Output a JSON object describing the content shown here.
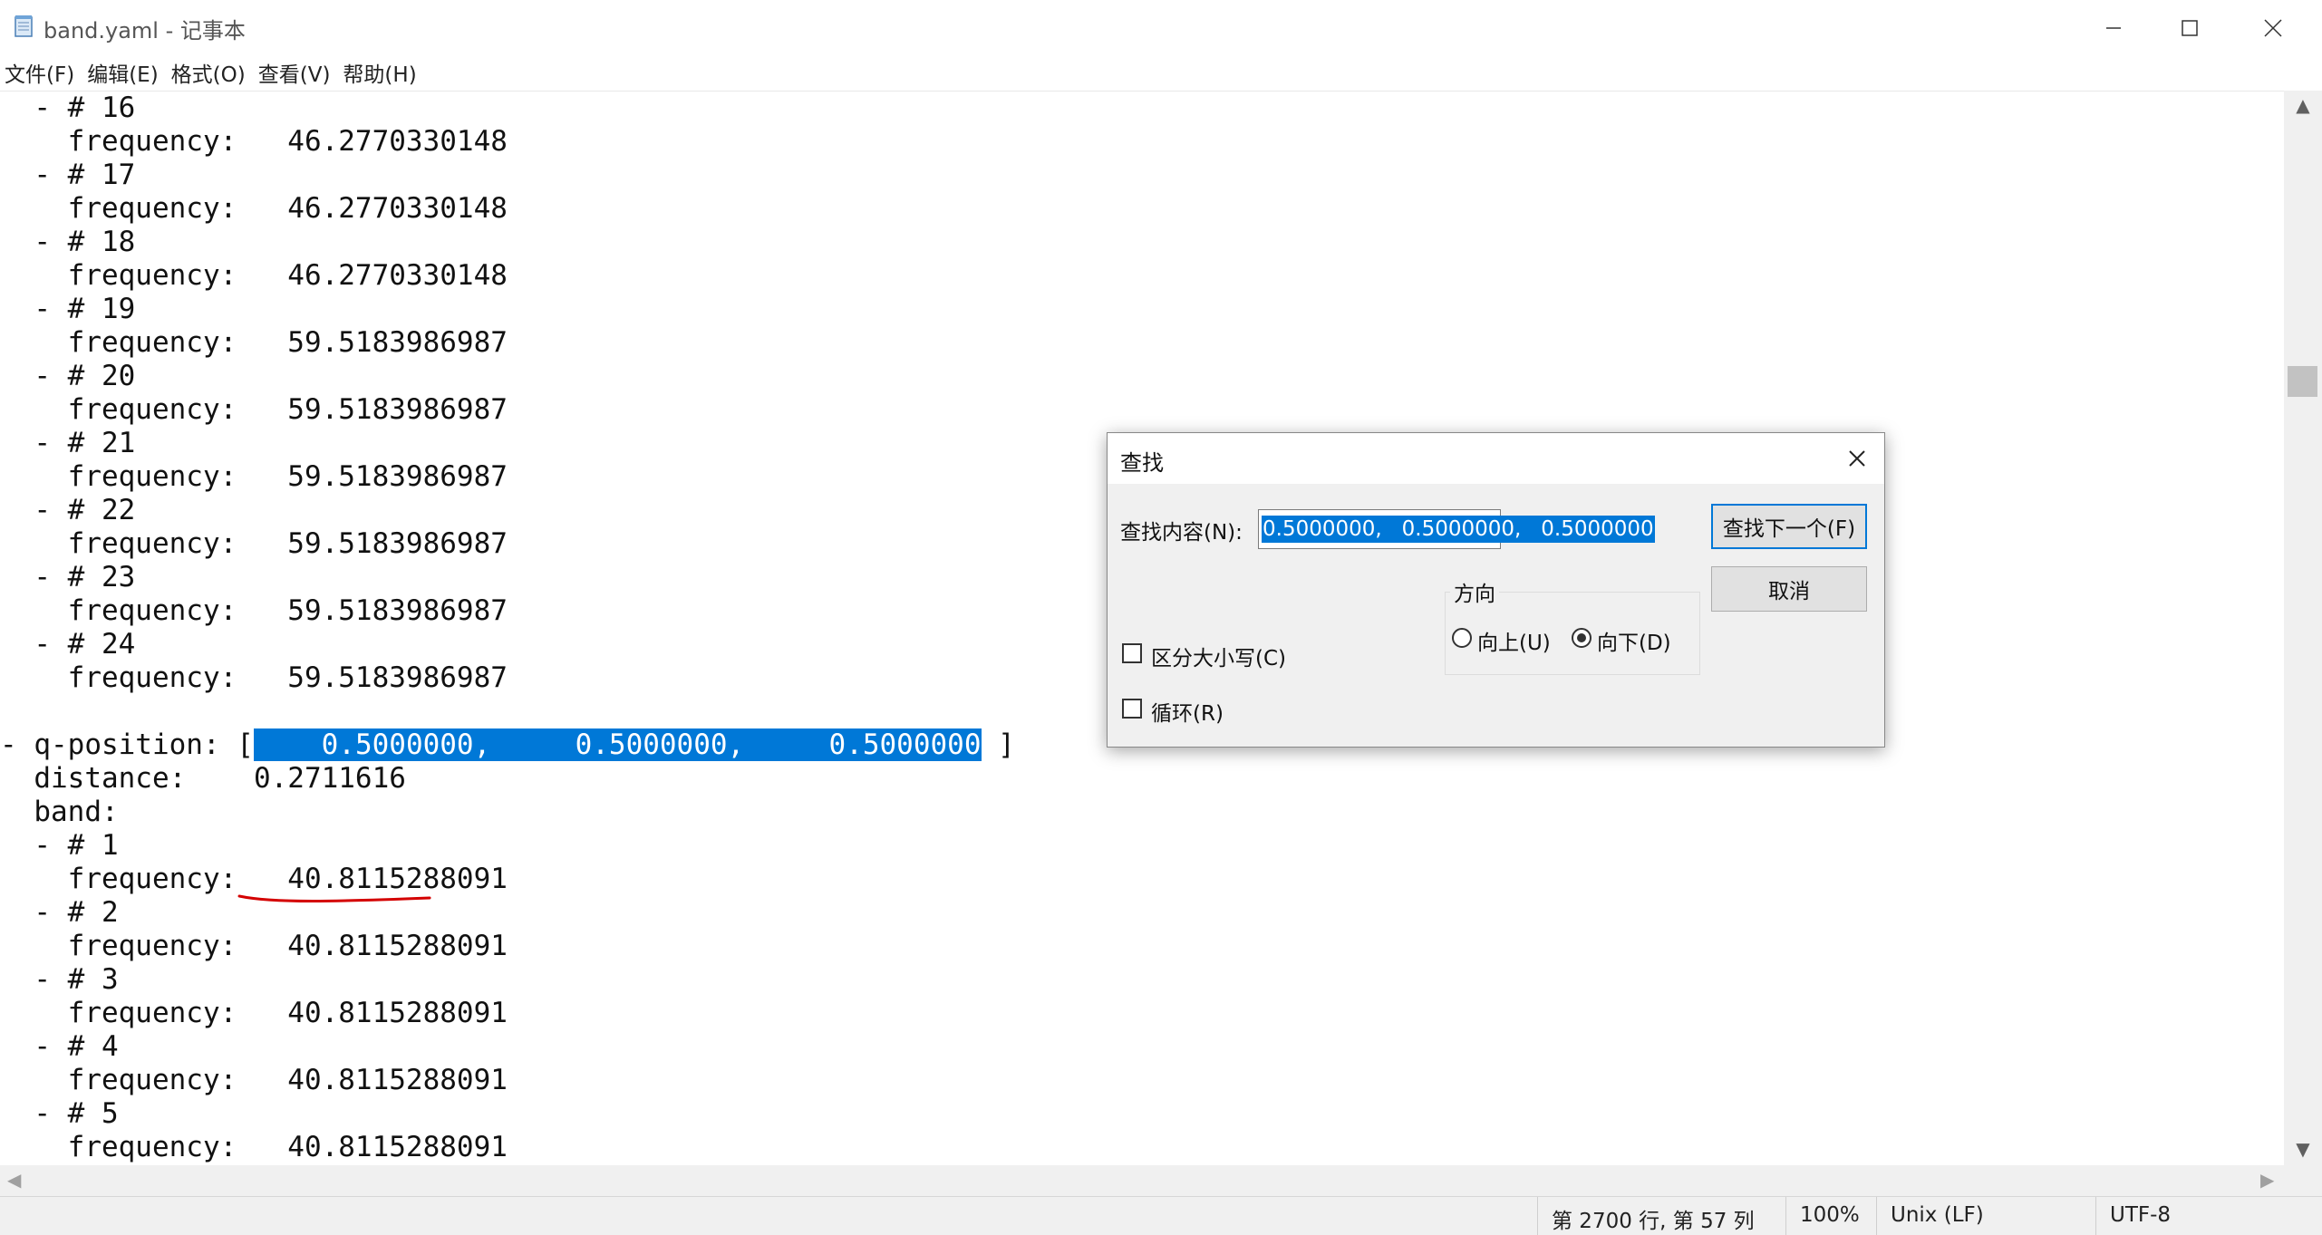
{
  "window": {
    "title": "band.yaml - 记事本",
    "icon": "notepad-icon",
    "controls": [
      "minimize-icon",
      "maximize-icon",
      "close-icon"
    ]
  },
  "menu": [
    "文件(F)",
    "编辑(E)",
    "格式(O)",
    "查看(V)",
    "帮助(H)"
  ],
  "editor": {
    "lines": [
      "  - # 16",
      "    frequency:   46.2770330148",
      "  - # 17",
      "    frequency:   46.2770330148",
      "  - # 18",
      "    frequency:   46.2770330148",
      "  - # 19",
      "    frequency:   59.5183986987",
      "  - # 20",
      "    frequency:   59.5183986987",
      "  - # 21",
      "    frequency:   59.5183986987",
      "  - # 22",
      "    frequency:   59.5183986987",
      "  - # 23",
      "    frequency:   59.5183986987",
      "  - # 24",
      "    frequency:   59.5183986987",
      "",
      "- q-position: [",
      "  distance:    0.2711616",
      "  band:",
      "  - # 1",
      "    frequency:   40.8115288091",
      "  - # 2",
      "    frequency:   40.8115288091",
      "  - # 3",
      "    frequency:   40.8115288091",
      "  - # 4",
      "    frequency:   40.8115288091",
      "  - # 5",
      "    frequency:   40.8115288091"
    ],
    "q_position_selected": "    0.5000000,     0.5000000,     0.5000000",
    "q_position_suffix": " ]"
  },
  "status": {
    "position": "第 2700 行, 第 57 列",
    "zoom": "100%",
    "line_ending": "Unix (LF)",
    "encoding": "UTF-8"
  },
  "find_dialog": {
    "title": "查找",
    "find_label": "查找内容(N):",
    "find_value": "0.5000000,   0.5000000,   0.5000000",
    "find_next": "查找下一个(F)",
    "cancel": "取消",
    "direction_label": "方向",
    "up": "向上(U)",
    "down": "向下(D)",
    "direction_selected": "down",
    "match_case": "区分大小写(C)",
    "match_case_checked": false,
    "wrap": "循环(R)",
    "wrap_checked": false
  },
  "colors": {
    "selection": "#0078d7",
    "annotation": "#d40000"
  }
}
